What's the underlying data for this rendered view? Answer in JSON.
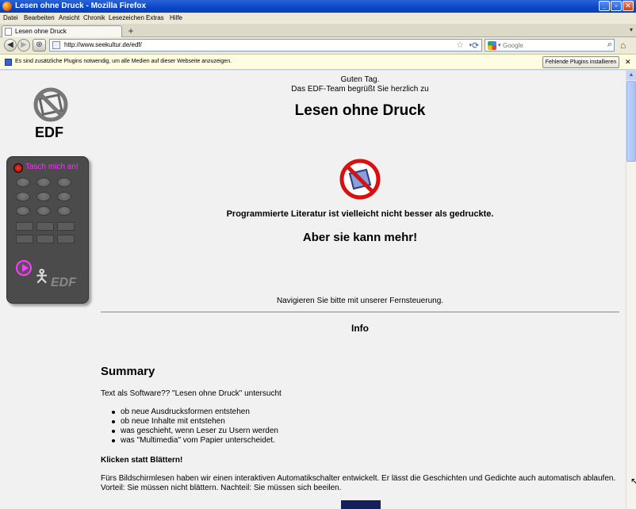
{
  "window": {
    "title": "Lesen ohne Druck - Mozilla Firefox"
  },
  "menu": [
    "Datei",
    "Bearbeiten",
    "Ansicht",
    "Chronik",
    "Lesezeichen",
    "Extras",
    "Hilfe"
  ],
  "tab": {
    "label": "Lesen ohne Druck"
  },
  "nav": {
    "url": "http://www.seekultur.de/edf/",
    "search_placeholder": "Google"
  },
  "plugin": {
    "message": "Es sind zusätzliche Plugins notwendig, um alle Medien auf dieser Webseite anzuzeigen.",
    "button": "Fehlende Plugins installieren ..."
  },
  "sidebar": {
    "logo": "EDF",
    "remote_title": "Tasch mich an!",
    "remote_logo": "EDF"
  },
  "page": {
    "greeting": "Guten Tag.",
    "welcome": "Das EDF-Team begrüßt Sie herzlich zu",
    "title": "Lesen ohne Druck",
    "lead": "Programmierte Literatur ist vielleicht nicht besser als gedruckte.",
    "more": "Aber sie kann mehr!",
    "nav_hint": "Navigieren Sie bitte mit unserer Fernsteuerung.",
    "info": "Info",
    "summary_heading": "Summary",
    "summary_intro": "Text als Software?? \"Lesen ohne Druck\" untersucht",
    "bullets": [
      "ob neue Ausdrucksformen entstehen",
      "ob neue Inhalte mit entstehen",
      "was geschieht, wenn Leser zu Usern werden",
      "was \"Multimedia\" vom Papier unterscheidet."
    ],
    "klicken_heading": "Klicken statt Blättern!",
    "klicken_text_1": "Fürs Bildschirmlesen haben wir einen interaktiven Automatikschalter entwickelt. Er lässt die Geschichten und Gedichte auch automatisch ablaufen.",
    "klicken_text_2": "Vorteil: Sie müssen nicht blättern. Nachteil: Sie müssen sich beeilen."
  }
}
